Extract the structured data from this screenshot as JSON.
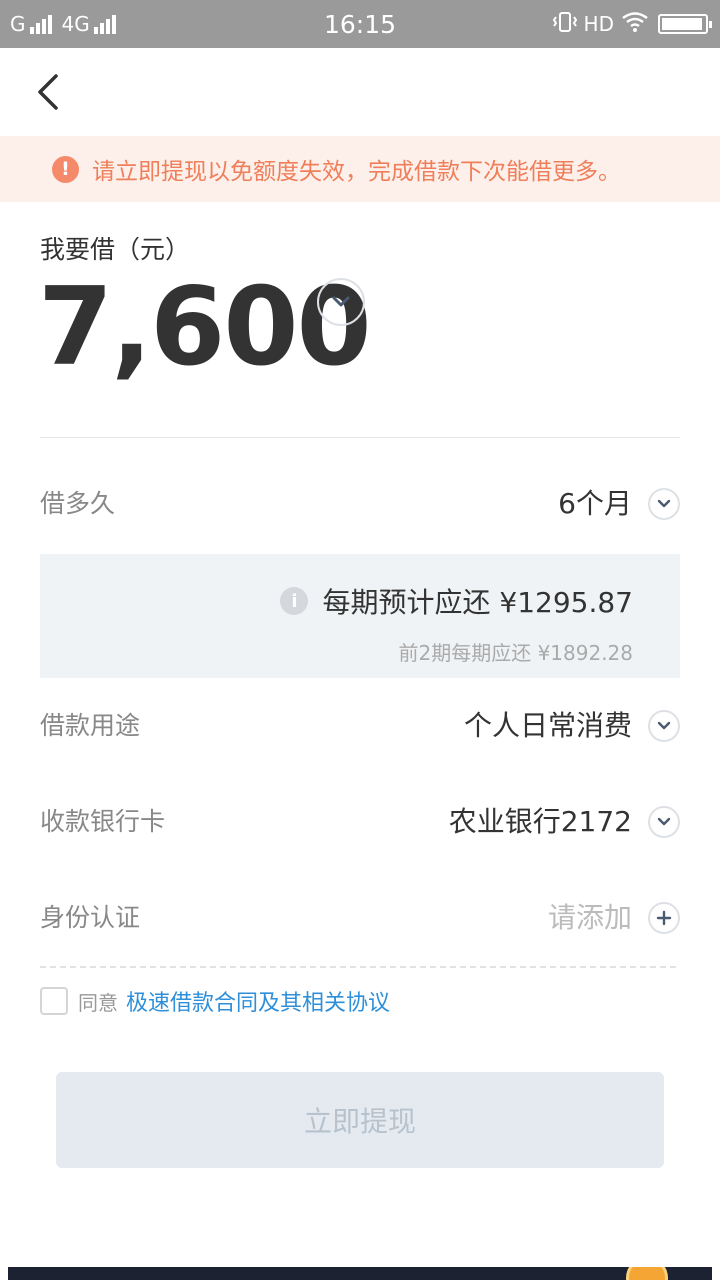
{
  "status_bar": {
    "carrier_left": "G",
    "network": "4G",
    "time": "16:15",
    "hd": "HD",
    "battery_level": 0.95
  },
  "notice": {
    "icon_glyph": "!",
    "text": "请立即提现以免额度失效，完成借款下次能借更多。",
    "color": "#ef7f5a"
  },
  "loan": {
    "amount_label": "我要借（元）",
    "amount": "7,600"
  },
  "term": {
    "label": "借多久",
    "value": "6个月"
  },
  "repayment": {
    "info_glyph": "i",
    "main": "每期预计应还 ¥1295.87",
    "sub": "前2期每期应还 ¥1892.28"
  },
  "purpose": {
    "label": "借款用途",
    "value": "个人日常消费"
  },
  "bank_card": {
    "label": "收款银行卡",
    "value": "农业银行2172"
  },
  "identity": {
    "label": "身份认证",
    "placeholder": "请添加"
  },
  "agreement": {
    "prefix": "同意",
    "link": "极速借款合同及其相关协议",
    "link_color": "#2f8fd8"
  },
  "submit": {
    "label": "立即提现"
  }
}
